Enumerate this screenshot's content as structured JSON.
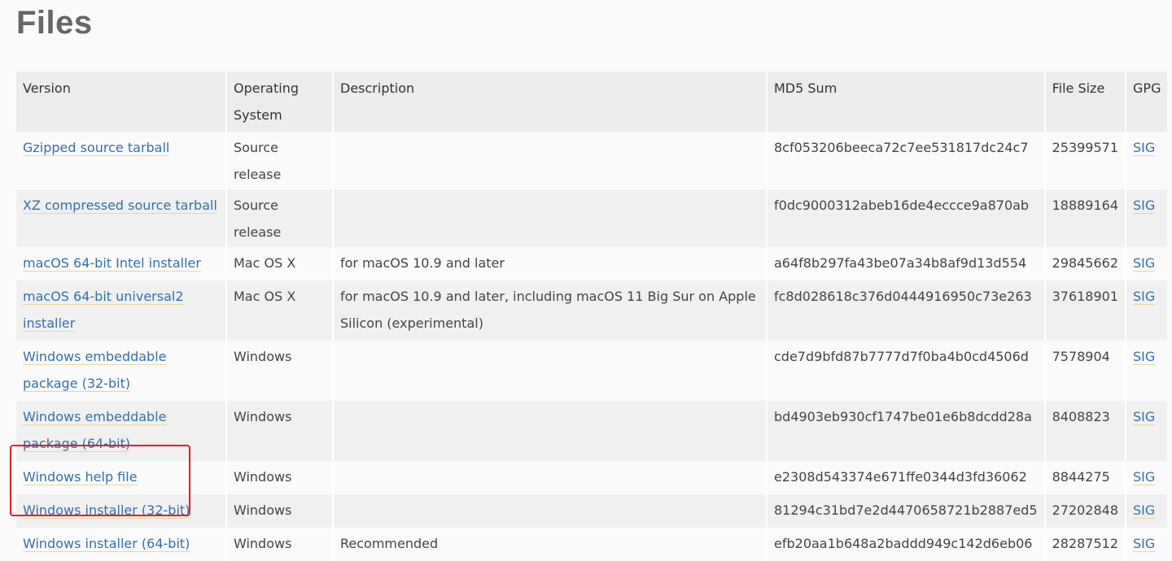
{
  "page": {
    "title": "Files"
  },
  "table": {
    "headers": {
      "version": "Version",
      "os_line1": "Operating",
      "os_line2": "System",
      "description": "Description",
      "md5": "MD5 Sum",
      "size": "File Size",
      "gpg": "GPG"
    },
    "rows": [
      {
        "version": "Gzipped source tarball",
        "os": "Source release",
        "description": "",
        "md5": "8cf053206beeca72c7ee531817dc24c7",
        "size": "25399571",
        "gpg": "SIG"
      },
      {
        "version": "XZ compressed source tarball",
        "os": "Source release",
        "description": "",
        "md5": "f0dc9000312abeb16de4eccce9a870ab",
        "size": "18889164",
        "gpg": "SIG"
      },
      {
        "version": "macOS 64-bit Intel installer",
        "os": "Mac OS X",
        "description": "for macOS 10.9 and later",
        "md5": "a64f8b297fa43be07a34b8af9d13d554",
        "size": "29845662",
        "gpg": "SIG"
      },
      {
        "version": "macOS 64-bit universal2 installer",
        "os": "Mac OS X",
        "description": "for macOS 10.9 and later, including macOS 11 Big Sur on Apple Silicon (experimental)",
        "md5": "fc8d028618c376d0444916950c73e263",
        "size": "37618901",
        "gpg": "SIG"
      },
      {
        "version": "Windows embeddable package (32-bit)",
        "os": "Windows",
        "description": "",
        "md5": "cde7d9bfd87b7777d7f0ba4b0cd4506d",
        "size": "7578904",
        "gpg": "SIG"
      },
      {
        "version": "Windows embeddable package (64-bit)",
        "os": "Windows",
        "description": "",
        "md5": "bd4903eb930cf1747be01e6b8dcdd28a",
        "size": "8408823",
        "gpg": "SIG"
      },
      {
        "version": "Windows help file",
        "os": "Windows",
        "description": "",
        "md5": "e2308d543374e671ffe0344d3fd36062",
        "size": "8844275",
        "gpg": "SIG"
      },
      {
        "version": "Windows installer (32-bit)",
        "os": "Windows",
        "description": "",
        "md5": "81294c31bd7e2d4470658721b2887ed5",
        "size": "27202848",
        "gpg": "SIG"
      },
      {
        "version": "Windows installer (64-bit)",
        "os": "Windows",
        "description": "Recommended",
        "md5": "efb20aa1b648a2baddd949c142d6eb06",
        "size": "28287512",
        "gpg": "SIG"
      }
    ]
  },
  "colors": {
    "link": "#3570a6",
    "highlight_border": "#e0202a",
    "header_bg": "#ececec",
    "stripe_bg": "#f0f0f0"
  }
}
